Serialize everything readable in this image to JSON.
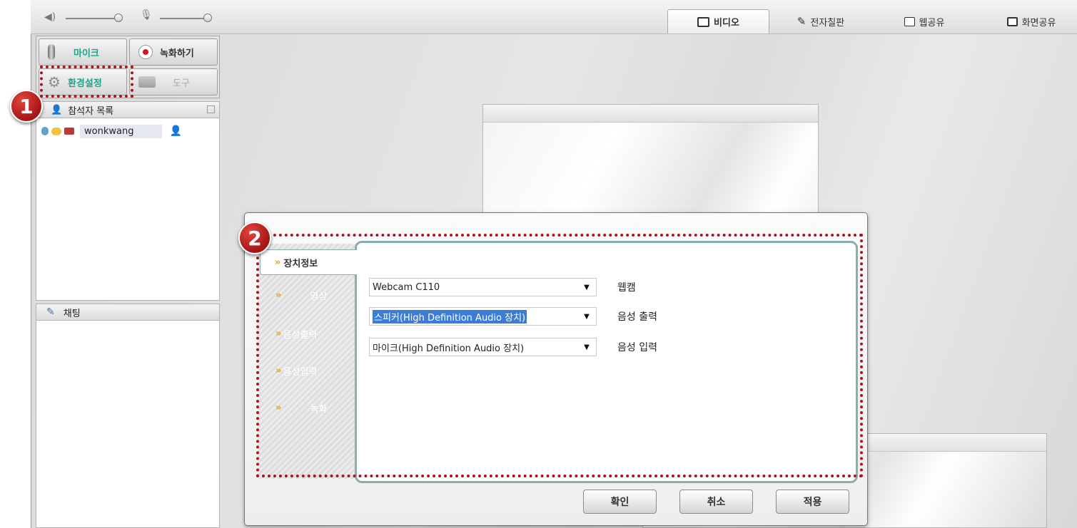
{
  "tabs": [
    {
      "label": "비디오",
      "icon": "tv-icon"
    },
    {
      "label": "전자칠판",
      "icon": "pen-board-icon"
    },
    {
      "label": "웹공유",
      "icon": "web-share-icon"
    },
    {
      "label": "화면공유",
      "icon": "monitor-icon"
    }
  ],
  "left_buttons": {
    "mic": "마이크",
    "record": "녹화하기",
    "settings": "환경설정",
    "tools": "도구"
  },
  "participants": {
    "title": "참석자 목록",
    "users": [
      {
        "name": "wonkwang"
      }
    ]
  },
  "chat": {
    "title": "채팅"
  },
  "dialog": {
    "side_tabs": [
      "장치정보",
      "영상",
      "음성출력",
      "음성입력",
      "녹화"
    ],
    "active_tab": "장치정보",
    "devices": [
      {
        "value": "Webcam C110",
        "label": "웹캠",
        "highlighted": false
      },
      {
        "value": "스피커(High Definition Audio 장치)",
        "label": "음성 출력",
        "highlighted": true
      },
      {
        "value": "마이크(High Definition Audio 장치)",
        "label": "음성 입력",
        "highlighted": false
      }
    ],
    "buttons": {
      "ok": "확인",
      "cancel": "취소",
      "apply": "적용"
    }
  },
  "annotations": {
    "badge1": "1",
    "badge2": "2"
  },
  "colors": {
    "accent_teal": "#1aa58d",
    "annotation_red": "#b0121b",
    "selection_blue": "#3a7cd6",
    "dialog_border": "#8aaeb0"
  }
}
